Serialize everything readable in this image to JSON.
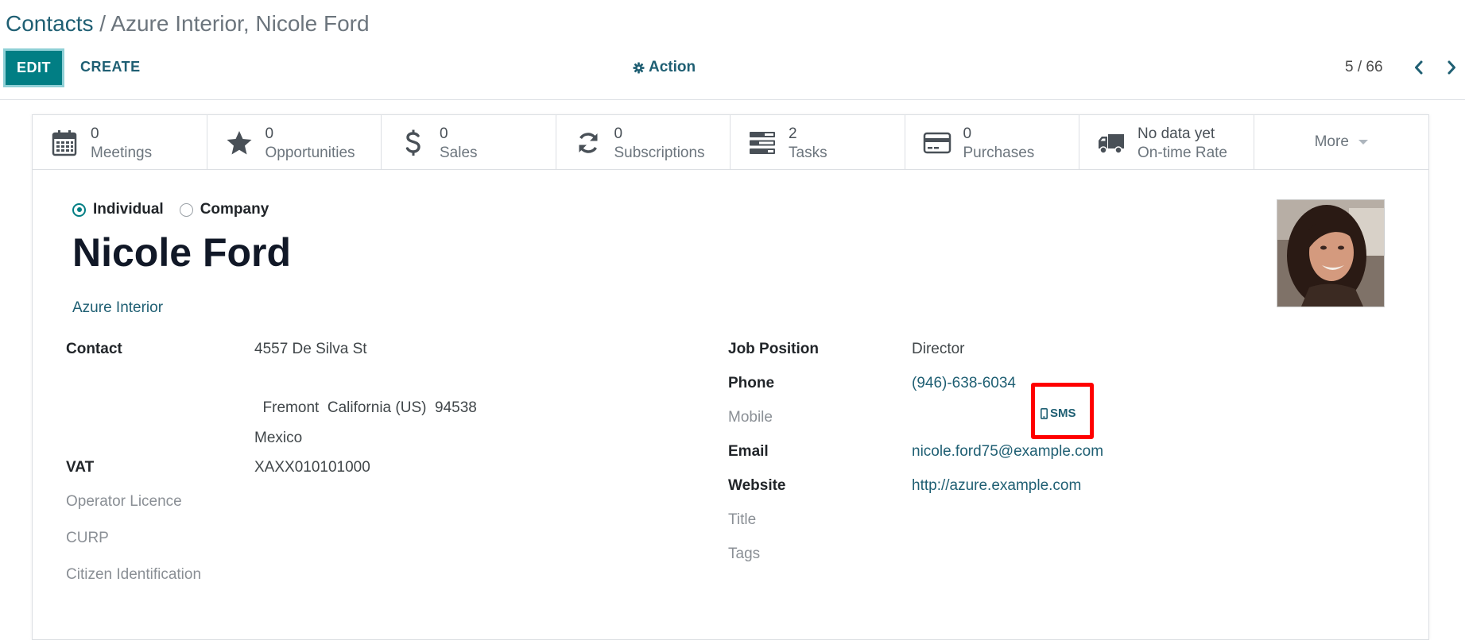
{
  "breadcrumb": {
    "root": "Contacts",
    "separator": "/",
    "current": "Azure Interior, Nicole Ford"
  },
  "toolbar": {
    "edit_label": "EDIT",
    "create_label": "CREATE",
    "action_label": "Action",
    "action_icon": "gear-icon"
  },
  "pager": {
    "value": "5 / 66",
    "prev_icon": "chevron-left-icon",
    "next_icon": "chevron-right-icon"
  },
  "stat_buttons": [
    {
      "value": "0",
      "label": "Meetings",
      "icon": "calendar-icon"
    },
    {
      "value": "0",
      "label": "Opportunities",
      "icon": "star-icon"
    },
    {
      "value": "0",
      "label": "Sales",
      "icon": "dollar-icon"
    },
    {
      "value": "0",
      "label": "Subscriptions",
      "icon": "refresh-icon"
    },
    {
      "value": "2",
      "label": "Tasks",
      "icon": "tasks-icon"
    },
    {
      "value": "0",
      "label": "Purchases",
      "icon": "credit-card-icon"
    },
    {
      "value": "No data yet",
      "label": "On-time Rate",
      "icon": "truck-icon"
    }
  ],
  "more_label": "More",
  "company_type": {
    "individual": "Individual",
    "company": "Company",
    "selected": "Individual"
  },
  "partner": {
    "name": "Nicole Ford",
    "parent": "Azure Interior"
  },
  "left_fields": {
    "contact_label": "Contact",
    "street": "4557 De Silva St",
    "city_line": "  Fremont  California (US)  94538",
    "country": "Mexico",
    "vat_label": "VAT",
    "vat": "XAXX010101000",
    "operator_licence_label": "Operator Licence",
    "curp_label": "CURP",
    "citizen_id_label": "Citizen Identification"
  },
  "right_fields": {
    "job_position_label": "Job Position",
    "job_position": "Director",
    "phone_label": "Phone",
    "phone": "(946)-638-6034",
    "sms_label": "SMS",
    "mobile_label": "Mobile",
    "email_label": "Email",
    "email": "nicole.ford75@example.com",
    "website_label": "Website",
    "website": "http://azure.example.com",
    "title_label": "Title",
    "tags_label": "Tags"
  },
  "colors": {
    "primary": "#017e84",
    "link": "#1f5f73",
    "highlight": "#ff0000"
  }
}
